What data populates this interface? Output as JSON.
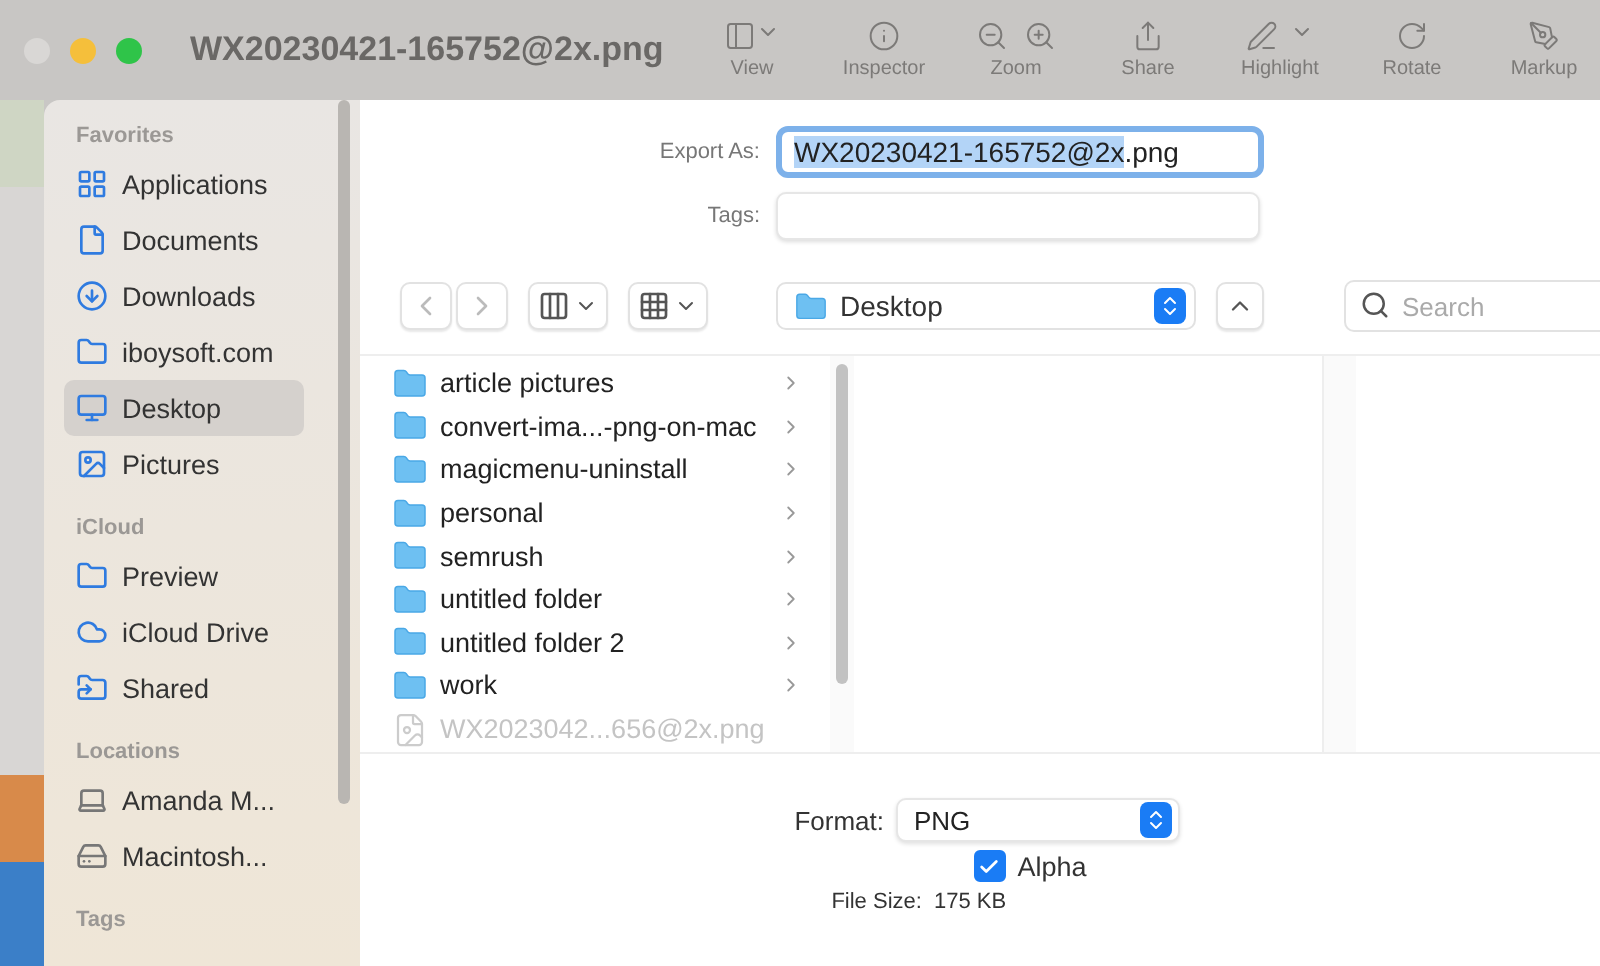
{
  "window": {
    "title": "WX20230421-165752@2x.png"
  },
  "toolbar": [
    {
      "label": "View",
      "kind": "view"
    },
    {
      "label": "Inspector",
      "kind": "inspector"
    },
    {
      "label": "Zoom",
      "kind": "zoom"
    },
    {
      "label": "Share",
      "kind": "share"
    },
    {
      "label": "Highlight",
      "kind": "highlight"
    },
    {
      "label": "Rotate",
      "kind": "rotate"
    },
    {
      "label": "Markup",
      "kind": "markup"
    }
  ],
  "sidebar": [
    {
      "title": "Favorites",
      "items": [
        {
          "label": "Applications",
          "kind": "apps",
          "selected": false
        },
        {
          "label": "Documents",
          "kind": "document",
          "selected": false
        },
        {
          "label": "Downloads",
          "kind": "download",
          "selected": false
        },
        {
          "label": "iboysoft.com",
          "kind": "folder",
          "selected": false
        },
        {
          "label": "Desktop",
          "kind": "desktop",
          "selected": true
        },
        {
          "label": "Pictures",
          "kind": "pictures",
          "selected": false
        }
      ]
    },
    {
      "title": "iCloud",
      "items": [
        {
          "label": "Preview",
          "kind": "folder",
          "selected": false
        },
        {
          "label": "iCloud Drive",
          "kind": "cloud",
          "selected": false
        },
        {
          "label": "Shared",
          "kind": "shared",
          "selected": false
        }
      ]
    },
    {
      "title": "Locations",
      "items": [
        {
          "label": "Amanda M...",
          "kind": "laptop",
          "selected": false
        },
        {
          "label": "Macintosh...",
          "kind": "drive",
          "selected": false
        }
      ]
    },
    {
      "title": "Tags"
    }
  ],
  "export_as": {
    "label": "Export As:",
    "value": "WX20230421-165752@2x.png"
  },
  "tags": {
    "label": "Tags:"
  },
  "location": {
    "value": "Desktop"
  },
  "search": {
    "placeholder": "Search"
  },
  "files": [
    {
      "name": "article pictures",
      "kind": "folder",
      "disabled": false
    },
    {
      "name": "convert-ima...-png-on-mac",
      "kind": "folder",
      "disabled": false
    },
    {
      "name": "magicmenu-uninstall",
      "kind": "folder",
      "disabled": false
    },
    {
      "name": "personal",
      "kind": "folder",
      "disabled": false
    },
    {
      "name": "semrush",
      "kind": "folder",
      "disabled": false
    },
    {
      "name": "untitled folder",
      "kind": "folder",
      "disabled": false
    },
    {
      "name": "untitled folder 2",
      "kind": "folder",
      "disabled": false
    },
    {
      "name": "work",
      "kind": "folder",
      "disabled": false
    },
    {
      "name": "WX2023042...656@2x.png",
      "kind": "file",
      "disabled": true
    }
  ],
  "format": {
    "label": "Format:",
    "value": "PNG"
  },
  "alpha": {
    "label": "Alpha",
    "checked": true
  },
  "file_size": {
    "label": "File Size:",
    "value": "175 KB"
  }
}
